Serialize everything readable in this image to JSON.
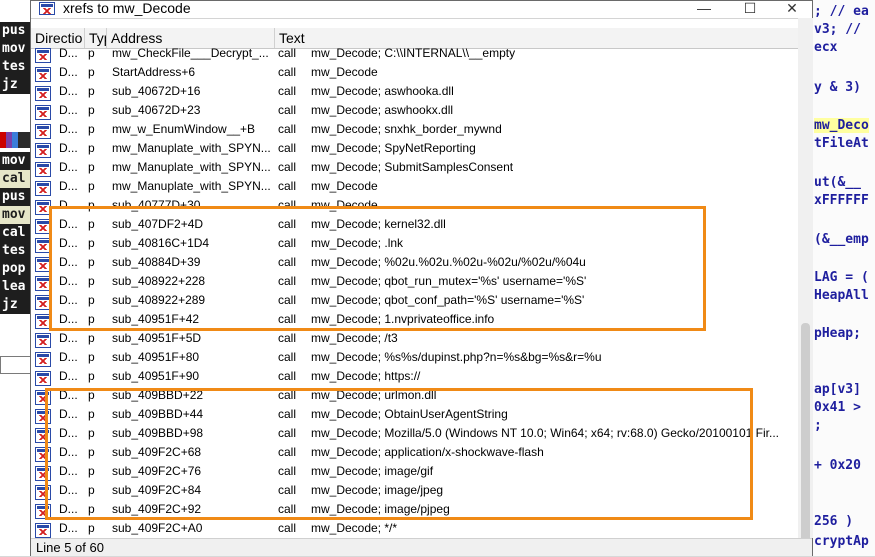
{
  "window": {
    "title": "xrefs to mw_Decode"
  },
  "columns": {
    "direction": "Directio",
    "type": "Typ",
    "address": "Address",
    "text": "Text"
  },
  "rows": [
    {
      "dir": "D...",
      "type": "p",
      "address": "mw_CheckFile___Decrypt_...",
      "kind": "call",
      "text": "mw_Decode; C:\\\\INTERNAL\\\\__empty"
    },
    {
      "dir": "D...",
      "type": "p",
      "address": "StartAddress+6",
      "kind": "call",
      "text": "mw_Decode"
    },
    {
      "dir": "D...",
      "type": "p",
      "address": "sub_40672D+16",
      "kind": "call",
      "text": "mw_Decode; aswhooka.dll"
    },
    {
      "dir": "D...",
      "type": "p",
      "address": "sub_40672D+23",
      "kind": "call",
      "text": "mw_Decode; aswhookx.dll"
    },
    {
      "dir": "D...",
      "type": "p",
      "address": "mw_w_EnumWindow__+B",
      "kind": "call",
      "text": "mw_Decode; snxhk_border_mywnd"
    },
    {
      "dir": "D...",
      "type": "p",
      "address": "mw_Manuplate_with_SPYN...",
      "kind": "call",
      "text": "mw_Decode; SpyNetReporting"
    },
    {
      "dir": "D...",
      "type": "p",
      "address": "mw_Manuplate_with_SPYN...",
      "kind": "call",
      "text": "mw_Decode; SubmitSamplesConsent"
    },
    {
      "dir": "D...",
      "type": "p",
      "address": "mw_Manuplate_with_SPYN...",
      "kind": "call",
      "text": "mw_Decode"
    },
    {
      "dir": "D...",
      "type": "p",
      "address": "sub_40777D+30",
      "kind": "call",
      "text": "mw_Decode"
    },
    {
      "dir": "D...",
      "type": "p",
      "address": "sub_407DF2+4D",
      "kind": "call",
      "text": "mw_Decode; kernel32.dll"
    },
    {
      "dir": "D...",
      "type": "p",
      "address": "sub_40816C+1D4",
      "kind": "call",
      "text": "mw_Decode; .lnk"
    },
    {
      "dir": "D...",
      "type": "p",
      "address": "sub_40884D+39",
      "kind": "call",
      "text": "mw_Decode; %02u.%02u.%02u-%02u/%02u/%04u"
    },
    {
      "dir": "D...",
      "type": "p",
      "address": "sub_408922+228",
      "kind": "call",
      "text": "mw_Decode; qbot_run_mutex='%s' username='%S'"
    },
    {
      "dir": "D...",
      "type": "p",
      "address": "sub_408922+289",
      "kind": "call",
      "text": "mw_Decode; qbot_conf_path='%S' username='%S'"
    },
    {
      "dir": "D...",
      "type": "p",
      "address": "sub_40951F+42",
      "kind": "call",
      "text": "mw_Decode; 1.nvprivateoffice.info"
    },
    {
      "dir": "D...",
      "type": "p",
      "address": "sub_40951F+5D",
      "kind": "call",
      "text": "mw_Decode; /t3"
    },
    {
      "dir": "D...",
      "type": "p",
      "address": "sub_40951F+80",
      "kind": "call",
      "text": "mw_Decode; %s%s/dupinst.php?n=%s&bg=%s&r=%u"
    },
    {
      "dir": "D...",
      "type": "p",
      "address": "sub_40951F+90",
      "kind": "call",
      "text": "mw_Decode; https://"
    },
    {
      "dir": "D...",
      "type": "p",
      "address": "sub_409BBD+22",
      "kind": "call",
      "text": "mw_Decode; urlmon.dll"
    },
    {
      "dir": "D...",
      "type": "p",
      "address": "sub_409BBD+44",
      "kind": "call",
      "text": "mw_Decode; ObtainUserAgentString"
    },
    {
      "dir": "D...",
      "type": "p",
      "address": "sub_409BBD+98",
      "kind": "call",
      "text": "mw_Decode; Mozilla/5.0 (Windows NT 10.0; Win64; x64; rv:68.0) Gecko/20100101 Fir..."
    },
    {
      "dir": "D...",
      "type": "p",
      "address": "sub_409F2C+68",
      "kind": "call",
      "text": "mw_Decode; application/x-shockwave-flash"
    },
    {
      "dir": "D...",
      "type": "p",
      "address": "sub_409F2C+76",
      "kind": "call",
      "text": "mw_Decode; image/gif"
    },
    {
      "dir": "D...",
      "type": "p",
      "address": "sub_409F2C+84",
      "kind": "call",
      "text": "mw_Decode; image/jpeg"
    },
    {
      "dir": "D...",
      "type": "p",
      "address": "sub_409F2C+92",
      "kind": "call",
      "text": "mw_Decode; image/pjpeg"
    },
    {
      "dir": "D...",
      "type": "p",
      "address": "sub_409F2C+A0",
      "kind": "call",
      "text": "mw_Decode; */*"
    }
  ],
  "status": {
    "line_info": "Line 5 of 60"
  },
  "background_left": {
    "asm_top": [
      "pus",
      "mov",
      "tes",
      "jz"
    ],
    "asm_mid": [
      "mov",
      "cal",
      "pus",
      "mov",
      "cal",
      "tes",
      "pop",
      "lea",
      "jz"
    ]
  },
  "background_right": {
    "lines": [
      "; // ea",
      "v3; //",
      "ecx",
      "y & 3)",
      "mw_Deco",
      "tFileAt",
      "ut(&__",
      "xFFFFFF",
      "(&__emp",
      "LAG = (",
      "HeapAll",
      "pHeap;",
      "ap[v3]",
      "0x41 >",
      ";",
      "+ 0x20",
      "256 )",
      "cryptAp"
    ]
  },
  "colors": {
    "annotation": "#f08a16",
    "icon_blue": "#2a4aa8",
    "icon_red": "#d42020"
  }
}
